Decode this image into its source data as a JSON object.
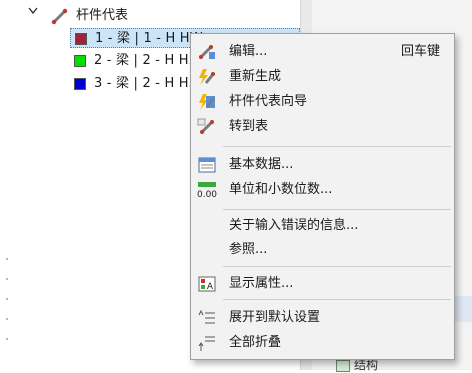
{
  "tree": {
    "root_label": "杆件代表",
    "items": [
      {
        "color": "#a0233b",
        "text": "1 - 梁 | 1 - H HW ..."
      },
      {
        "color": "#00e000",
        "text": "2 - 梁 | 2 - H H..."
      },
      {
        "color": "#0000d0",
        "text": "3 - 梁 | 2 - H H..."
      }
    ]
  },
  "right_pane": {
    "item_label": "结构"
  },
  "menu": {
    "items": [
      {
        "icon": "edit-icon",
        "label": "编辑...",
        "shortcut": "回车键"
      },
      {
        "icon": "regenerate-icon",
        "label": "重新生成"
      },
      {
        "icon": "wizard-icon",
        "label": "杆件代表向导"
      },
      {
        "icon": "table-icon",
        "label": "转到表"
      },
      {
        "icon": "basic-data-icon",
        "label": "基本数据..."
      },
      {
        "icon": "units-decimals-icon",
        "label": "单位和小数位数..."
      },
      {
        "icon": "",
        "label": "关于输入错误的信息..."
      },
      {
        "icon": "",
        "label": "参照..."
      },
      {
        "icon": "display-properties-icon",
        "label": "显示属性..."
      },
      {
        "icon": "expand-default-icon",
        "label": "展开到默认设置"
      },
      {
        "icon": "collapse-all-icon",
        "label": "全部折叠"
      }
    ]
  }
}
